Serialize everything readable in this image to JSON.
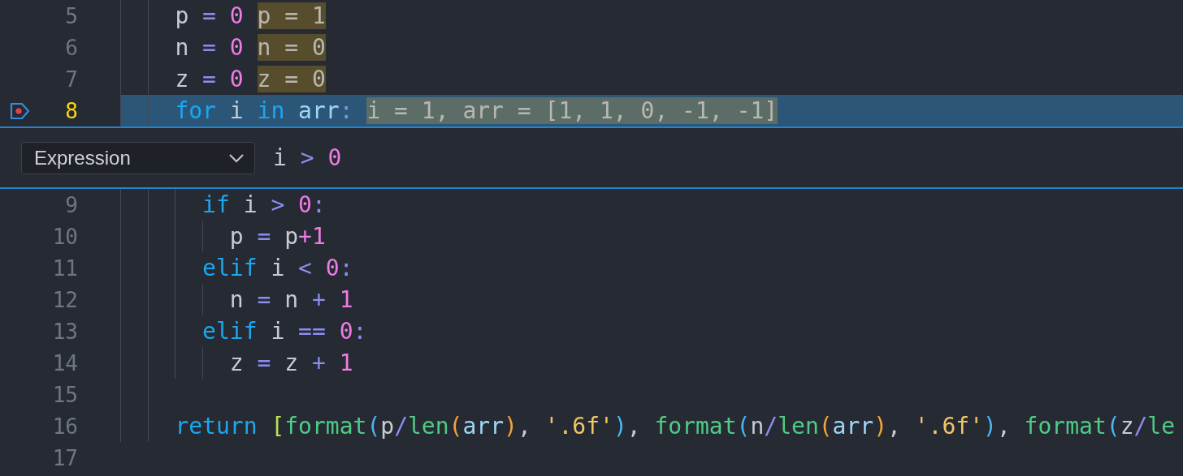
{
  "lines_before": [
    {
      "number": "5",
      "current": false,
      "breakpoint": false,
      "words": [
        [
          {
            "text": "p",
            "kind": "variable"
          }
        ],
        [
          {
            "text": "=",
            "kind": "operator"
          }
        ],
        [
          {
            "text": "0",
            "kind": "number"
          }
        ]
      ],
      "inline_value": {
        "text": "p = 1",
        "changed": true
      }
    },
    {
      "number": "6",
      "current": false,
      "breakpoint": false,
      "words": [
        [
          {
            "text": "n",
            "kind": "variable"
          }
        ],
        [
          {
            "text": "=",
            "kind": "operator"
          }
        ],
        [
          {
            "text": "0",
            "kind": "number"
          }
        ]
      ],
      "inline_value": {
        "text": "n = 0",
        "changed": true
      }
    },
    {
      "number": "7",
      "current": false,
      "breakpoint": false,
      "words": [
        [
          {
            "text": "z",
            "kind": "variable"
          }
        ],
        [
          {
            "text": "=",
            "kind": "operator"
          }
        ],
        [
          {
            "text": "0",
            "kind": "number"
          }
        ]
      ],
      "inline_value": {
        "text": "z = 0",
        "changed": true
      }
    },
    {
      "number": "8",
      "current": true,
      "breakpoint": true,
      "words": [
        [
          {
            "text": "for",
            "kind": "keyword"
          }
        ],
        [
          {
            "text": "i",
            "kind": "variable"
          }
        ],
        [
          {
            "text": "in",
            "kind": "keyword"
          }
        ],
        [
          {
            "text": "arr",
            "kind": "parameter"
          },
          {
            "text": ":",
            "kind": "operator"
          }
        ]
      ],
      "inline_value": {
        "text": "i = 1, arr = [1, 1, 0, -1, -1]",
        "changed": false
      }
    }
  ],
  "breakpoint_widget": {
    "condition_type": "Expression",
    "expression": [
      [
        {
          "text": "i",
          "kind": "variable"
        }
      ],
      [
        {
          "text": ">",
          "kind": "operator"
        }
      ],
      [
        {
          "text": "0",
          "kind": "number"
        }
      ]
    ]
  },
  "loop_body": [
    {
      "number": "9",
      "current": false,
      "breakpoint": false,
      "words": [
        [
          {
            "text": "if",
            "kind": "keyword"
          }
        ],
        [
          {
            "text": "i",
            "kind": "variable"
          }
        ],
        [
          {
            "text": ">",
            "kind": "operator"
          }
        ],
        [
          {
            "text": "0",
            "kind": "number"
          },
          {
            "text": ":",
            "kind": "operator"
          }
        ]
      ],
      "children": [
        {
          "number": "10",
          "current": false,
          "breakpoint": false,
          "words": [
            [
              {
                "text": "p",
                "kind": "variable"
              }
            ],
            [
              {
                "text": "=",
                "kind": "operator"
              }
            ],
            [
              {
                "text": "p",
                "kind": "variable"
              },
              {
                "text": "+",
                "kind": "number"
              },
              {
                "text": "1",
                "kind": "number"
              }
            ]
          ]
        }
      ]
    },
    {
      "number": "11",
      "current": false,
      "breakpoint": false,
      "words": [
        [
          {
            "text": "elif",
            "kind": "keyword"
          }
        ],
        [
          {
            "text": "i",
            "kind": "variable"
          }
        ],
        [
          {
            "text": "<",
            "kind": "operator"
          }
        ],
        [
          {
            "text": "0",
            "kind": "number"
          },
          {
            "text": ":",
            "kind": "operator"
          }
        ]
      ],
      "children": [
        {
          "number": "12",
          "current": false,
          "breakpoint": false,
          "words": [
            [
              {
                "text": "n",
                "kind": "variable"
              }
            ],
            [
              {
                "text": "=",
                "kind": "operator"
              }
            ],
            [
              {
                "text": "n",
                "kind": "variable"
              }
            ],
            [
              {
                "text": "+",
                "kind": "operator"
              }
            ],
            [
              {
                "text": "1",
                "kind": "number"
              }
            ]
          ]
        }
      ]
    },
    {
      "number": "13",
      "current": false,
      "breakpoint": false,
      "words": [
        [
          {
            "text": "elif",
            "kind": "keyword"
          }
        ],
        [
          {
            "text": "i",
            "kind": "variable"
          }
        ],
        [
          {
            "text": "==",
            "kind": "operator"
          }
        ],
        [
          {
            "text": "0",
            "kind": "number"
          },
          {
            "text": ":",
            "kind": "operator"
          }
        ]
      ],
      "children": [
        {
          "number": "14",
          "current": false,
          "breakpoint": false,
          "words": [
            [
              {
                "text": "z",
                "kind": "variable"
              }
            ],
            [
              {
                "text": "=",
                "kind": "operator"
              }
            ],
            [
              {
                "text": "z",
                "kind": "variable"
              }
            ],
            [
              {
                "text": "+",
                "kind": "operator"
              }
            ],
            [
              {
                "text": "1",
                "kind": "number"
              }
            ]
          ]
        }
      ]
    }
  ],
  "function_end": [
    {
      "number": "15",
      "current": false,
      "breakpoint": false
    },
    {
      "number": "16",
      "current": false,
      "breakpoint": false,
      "words": [
        [
          {
            "text": "return",
            "kind": "keyword"
          }
        ],
        [
          {
            "text": "[",
            "kind": "bracket1"
          },
          {
            "text": "format",
            "kind": "function"
          },
          {
            "text": "(",
            "kind": "bracket2"
          },
          {
            "text": "p",
            "kind": "variable"
          },
          {
            "text": "/",
            "kind": "operator"
          },
          {
            "text": "len",
            "kind": "function"
          },
          {
            "text": "(",
            "kind": "bracket3"
          },
          {
            "text": "arr",
            "kind": "parameter"
          },
          {
            "text": ")",
            "kind": "bracket3"
          },
          {
            "text": ",",
            "kind": "variable"
          }
        ],
        [
          {
            "text": "'.6f'",
            "kind": "string"
          },
          {
            "text": ")",
            "kind": "bracket2"
          },
          {
            "text": ",",
            "kind": "variable"
          }
        ],
        [
          {
            "text": "format",
            "kind": "function"
          },
          {
            "text": "(",
            "kind": "bracket2"
          },
          {
            "text": "n",
            "kind": "variable"
          },
          {
            "text": "/",
            "kind": "operator"
          },
          {
            "text": "len",
            "kind": "function"
          },
          {
            "text": "(",
            "kind": "bracket3"
          },
          {
            "text": "arr",
            "kind": "parameter"
          },
          {
            "text": ")",
            "kind": "bracket3"
          },
          {
            "text": ",",
            "kind": "variable"
          }
        ],
        [
          {
            "text": "'.6f'",
            "kind": "string"
          },
          {
            "text": ")",
            "kind": "bracket2"
          },
          {
            "text": ",",
            "kind": "variable"
          }
        ],
        [
          {
            "text": "format",
            "kind": "function"
          },
          {
            "text": "(",
            "kind": "bracket2"
          },
          {
            "text": "z",
            "kind": "variable"
          },
          {
            "text": "/",
            "kind": "operator"
          },
          {
            "text": "le",
            "kind": "function"
          }
        ]
      ]
    }
  ],
  "trailing": [
    {
      "number": "17",
      "current": false,
      "breakpoint": false
    }
  ]
}
